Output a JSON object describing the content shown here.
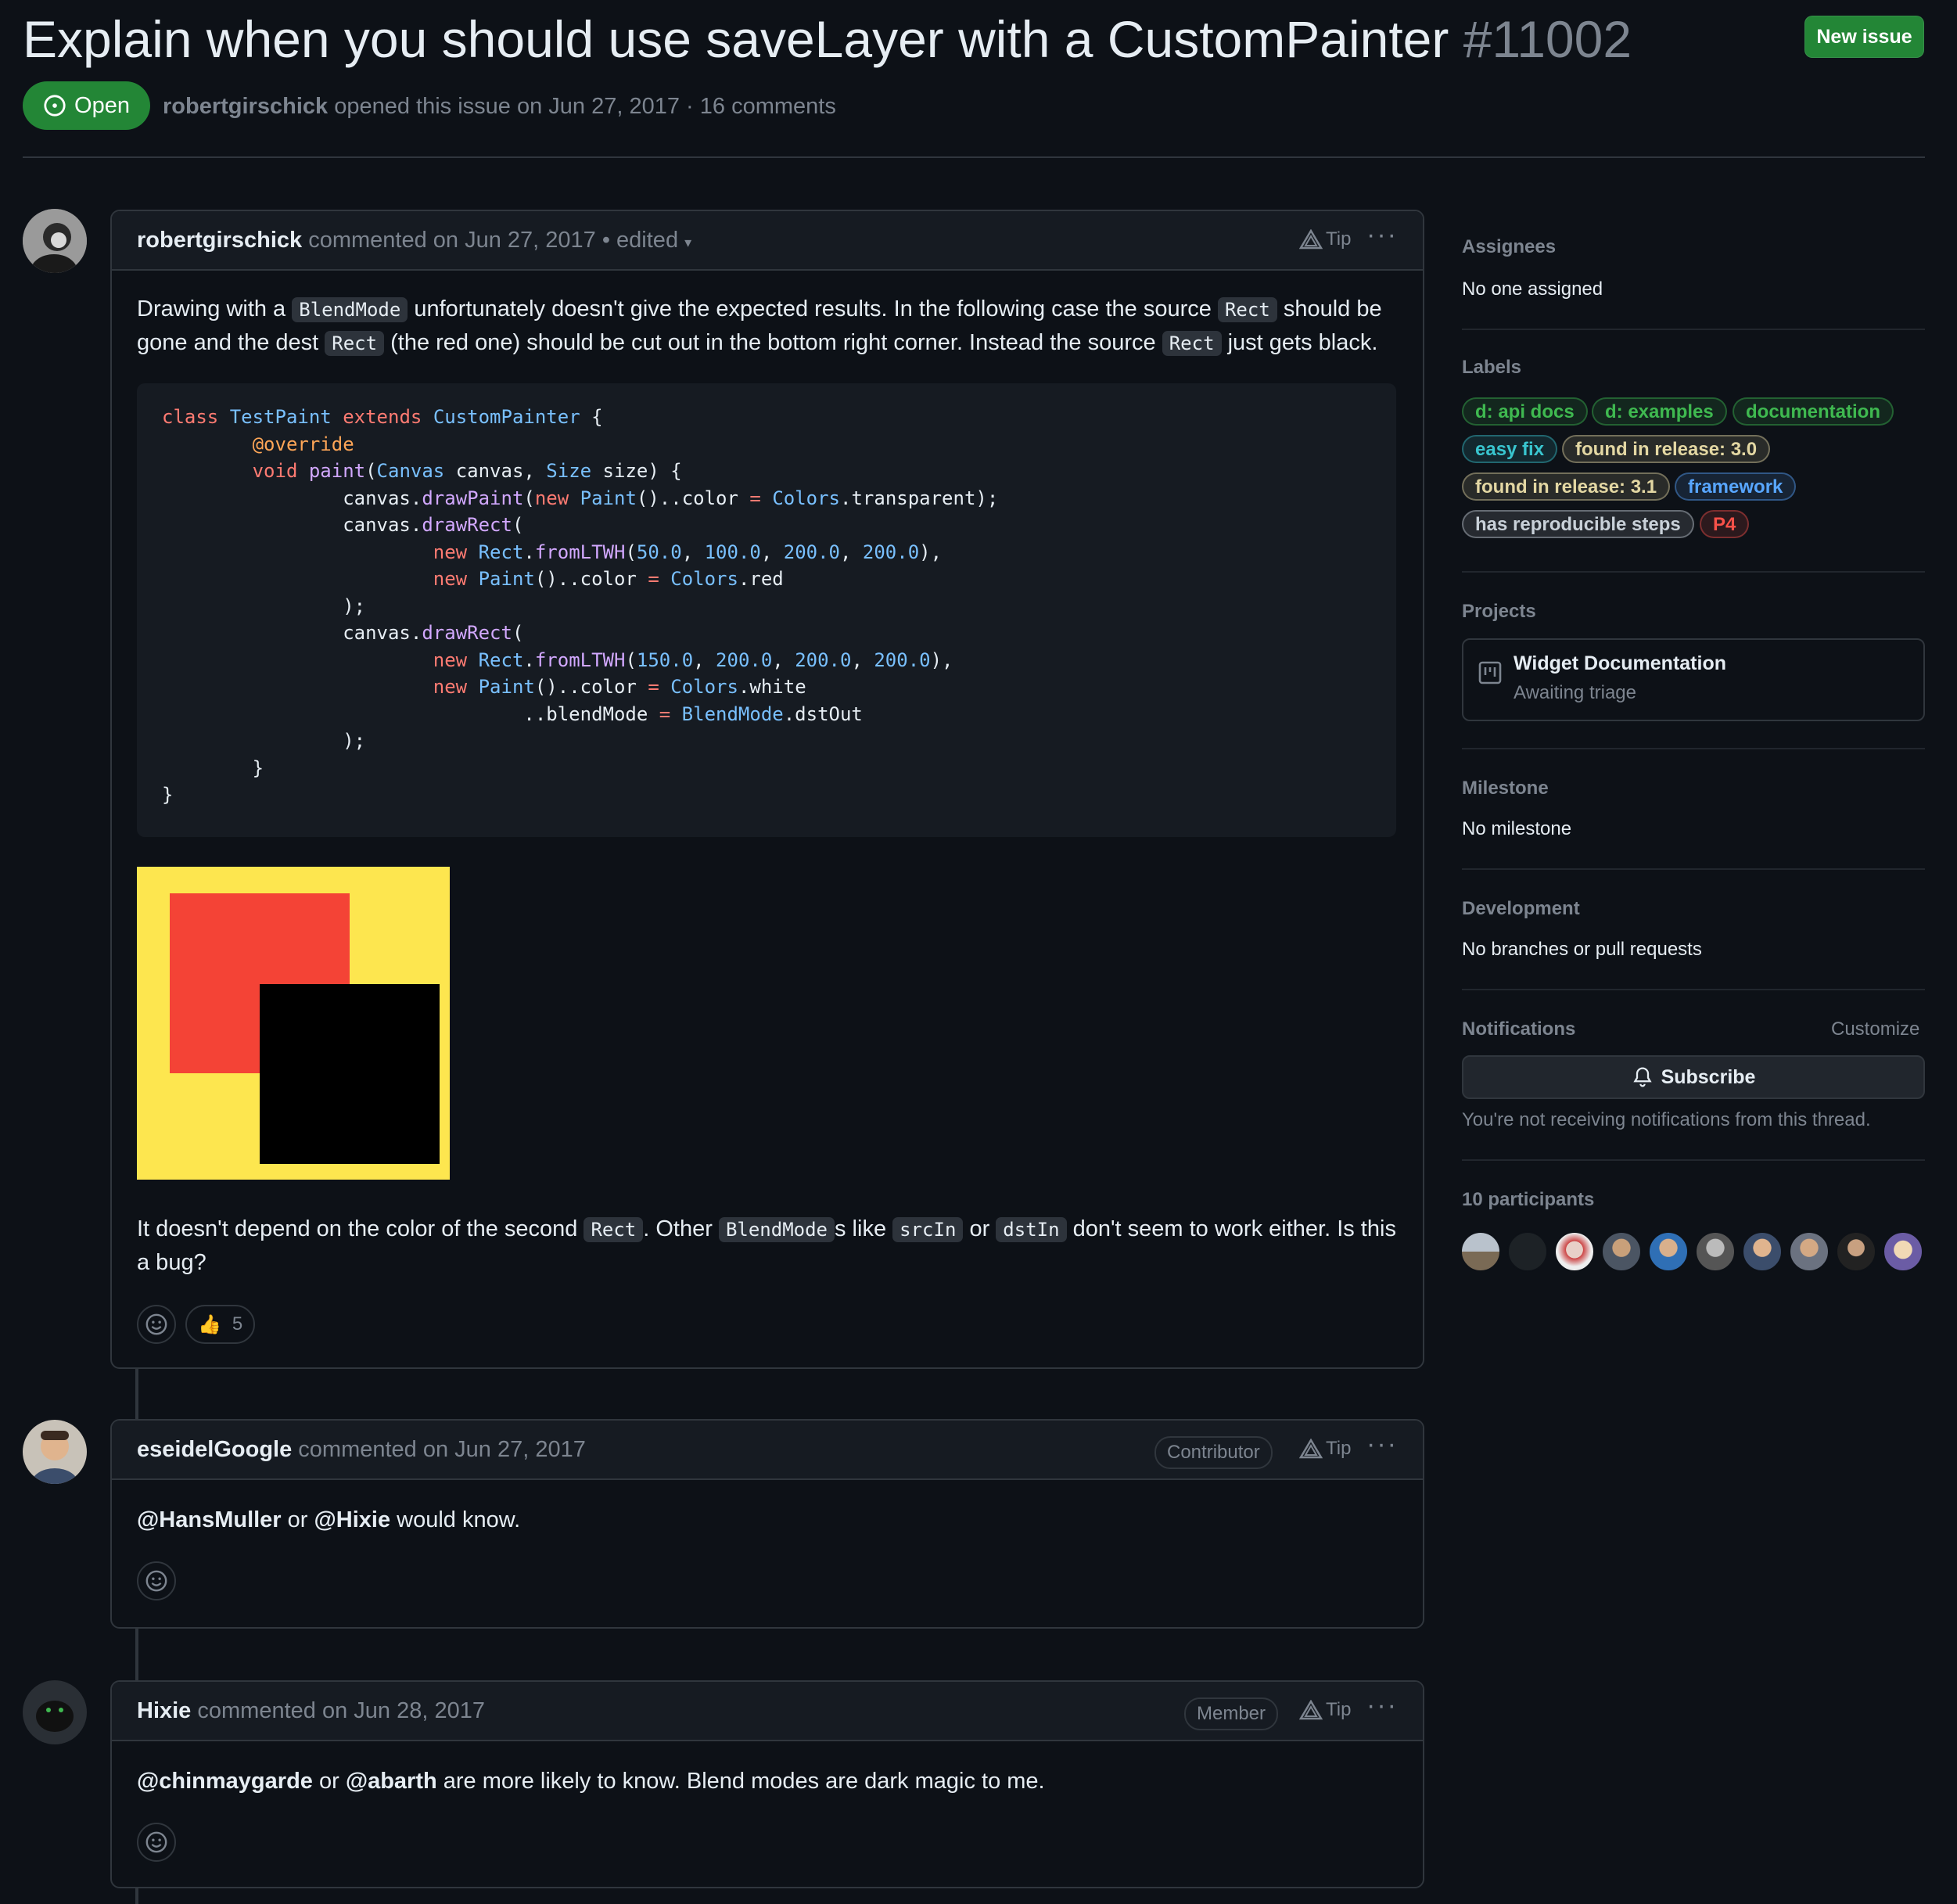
{
  "issue": {
    "title": "Explain when you should use saveLayer with a CustomPainter",
    "number": "#11002",
    "state": "Open",
    "new_issue_label": "New issue",
    "author": "robertgirschick",
    "meta_text": "opened this issue on Jun 27, 2017 · 16 comments"
  },
  "comments": [
    {
      "author": "robertgirschick",
      "meta": "commented on Jun 27, 2017 • edited",
      "tip": "Tip",
      "p1": [
        "Drawing with a ",
        "BlendMode",
        " unfortunately doesn't give the expected results. In the following case the source ",
        "Rect",
        " should be gone and the dest ",
        "Rect",
        " (the red one) should be cut out in the bottom right corner. Instead the source ",
        "Rect",
        " just gets black."
      ],
      "p2": [
        "It doesn't depend on the color of the second ",
        "Rect",
        ". Other ",
        "BlendMode",
        "s like ",
        "srcIn",
        " or ",
        "dstIn",
        " don't seem to work either. Is this a bug?"
      ],
      "thumbs_count": "5",
      "image_colors": {
        "background": "#fde64f",
        "dest": "#f44336",
        "source": "#000000"
      }
    },
    {
      "author": "eseidelGoogle",
      "meta": "commented on Jun 27, 2017",
      "role": "Contributor",
      "tip": "Tip",
      "body": [
        "@HansMuller",
        " or ",
        "@Hixie",
        " would know."
      ]
    },
    {
      "author": "Hixie",
      "meta": "commented on Jun 28, 2017",
      "role": "Member",
      "tip": "Tip",
      "body": [
        "@chinmaygarde",
        " or ",
        "@abarth",
        " are more likely to know. Blend modes are dark magic to me."
      ]
    }
  ],
  "sidebar": {
    "assignees": {
      "heading": "Assignees",
      "value": "No one assigned"
    },
    "labels": {
      "heading": "Labels",
      "items": [
        {
          "name": "d: api docs",
          "color": "#3fb950"
        },
        {
          "name": "d: examples",
          "color": "#3fb950"
        },
        {
          "name": "documentation",
          "color": "#3fb950"
        },
        {
          "name": "easy fix",
          "color": "#39c5cf"
        },
        {
          "name": "found in release: 3.0",
          "color": "#e3d7a3"
        },
        {
          "name": "found in release: 3.1",
          "color": "#e3d7a3"
        },
        {
          "name": "framework",
          "color": "#58a6ff"
        },
        {
          "name": "has reproducible steps",
          "color": "#c9d1d9"
        },
        {
          "name": "P4",
          "color": "#f85149"
        }
      ]
    },
    "projects": {
      "heading": "Projects",
      "name": "Widget Documentation",
      "status": "Awaiting triage"
    },
    "milestone": {
      "heading": "Milestone",
      "value": "No milestone"
    },
    "development": {
      "heading": "Development",
      "value": "No branches or pull requests"
    },
    "notifications": {
      "heading": "Notifications",
      "customize": "Customize",
      "button": "Subscribe",
      "note": "You're not receiving notifications from this thread."
    },
    "participants": {
      "heading": "10 participants",
      "count": 10
    }
  }
}
